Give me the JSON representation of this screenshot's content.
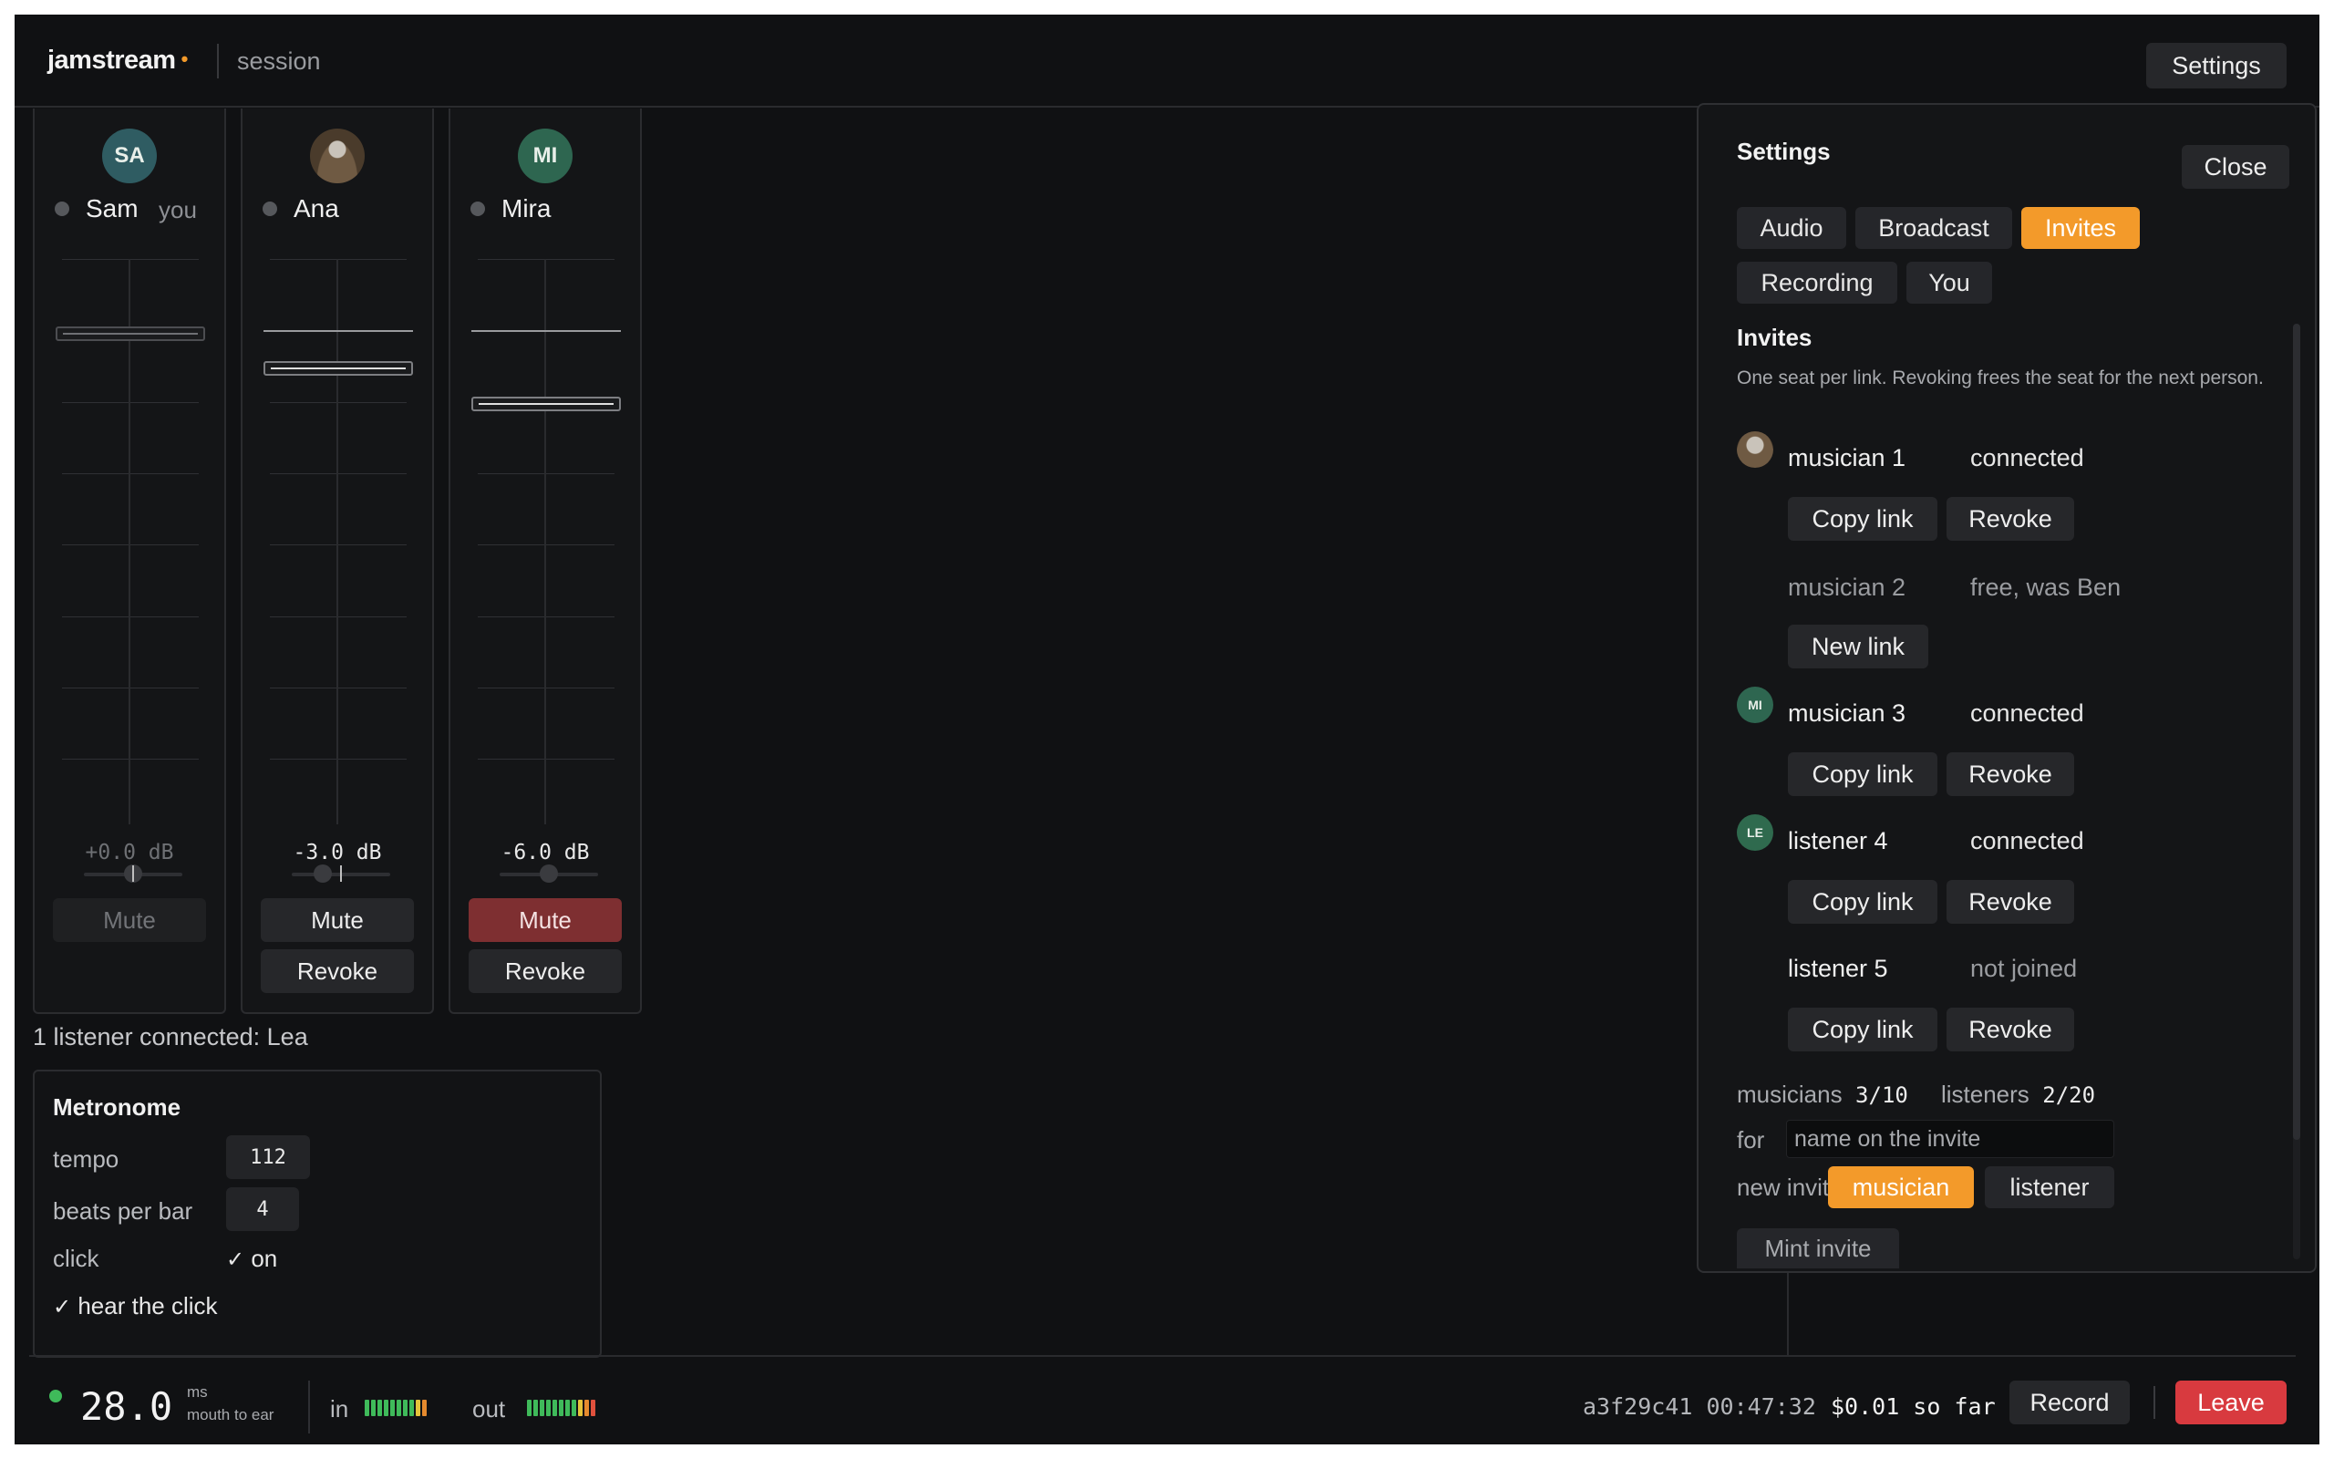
{
  "header": {
    "brand": "jamstream",
    "brand_dot": "•",
    "session_label": "session",
    "settings_button": "Settings"
  },
  "channels": [
    {
      "initials": "SA",
      "name": "Sam",
      "tag": "you",
      "db": "+0.0 dB",
      "mute_label": "Mute",
      "muted": false
    },
    {
      "initials": "",
      "name": "Ana",
      "tag": "",
      "db": "-3.0 dB",
      "mute_label": "Mute",
      "revoke_label": "Revoke",
      "muted": false
    },
    {
      "initials": "MI",
      "name": "Mira",
      "tag": "",
      "db": "-6.0 dB",
      "mute_label": "Mute",
      "revoke_label": "Revoke",
      "muted": true
    }
  ],
  "listeners_line": "1 listener connected: Lea",
  "metronome": {
    "title": "Metronome",
    "tempo_label": "tempo",
    "tempo_value": "112",
    "beats_label": "beats per bar",
    "beats_value": "4",
    "click_label": "click",
    "click_check": "✓",
    "click_value": "on",
    "hear_check": "✓",
    "hear_label": "hear the click"
  },
  "bottombar": {
    "latency": "28.0",
    "latency_unit": "ms",
    "latency_sub": "mouth to ear",
    "in_label": "in",
    "out_label": "out",
    "session_id": "a3f29c41",
    "elapsed": "00:47:32",
    "cost": "$0.01 so far",
    "record_button": "Record",
    "leave_button": "Leave"
  },
  "settings": {
    "title": "Settings",
    "close_button": "Close",
    "tabs": [
      "Audio",
      "Broadcast",
      "Invites",
      "Recording",
      "You"
    ],
    "active_tab": "Invites",
    "section_title": "Invites",
    "section_desc": "One seat per link. Revoking frees the seat for the next person.",
    "invites": [
      {
        "avatar": "",
        "name": "musician 1",
        "status": "connected",
        "buttons": [
          "Copy link",
          "Revoke"
        ]
      },
      {
        "avatar": "",
        "name": "musician 2",
        "status": "free, was Ben",
        "buttons": [
          "New link"
        ]
      },
      {
        "avatar": "MI",
        "name": "musician 3",
        "status": "connected",
        "buttons": [
          "Copy link",
          "Revoke"
        ]
      },
      {
        "avatar": "LE",
        "name": "listener 4",
        "status": "connected",
        "buttons": [
          "Copy link",
          "Revoke"
        ]
      },
      {
        "avatar": "",
        "name": "listener 5",
        "status": "not joined",
        "buttons": [
          "Copy link",
          "Revoke"
        ]
      }
    ],
    "musicians_label": "musicians",
    "musicians_count": "3/10",
    "listeners_label": "listeners",
    "listeners_count": "2/20",
    "for_label": "for",
    "for_placeholder": "name on the invite",
    "new_invite_label": "new invite",
    "invite_types": [
      "musician",
      "listener"
    ],
    "selected_invite_type": "musician",
    "mint_button": "Mint invite"
  },
  "colors": {
    "accent": "#f39a2a",
    "danger": "#d83a3f",
    "muted": "#7e2f31",
    "ok": "#3fba5a"
  },
  "icons": {
    "status": "status-dot-icon",
    "check": "check-icon"
  }
}
